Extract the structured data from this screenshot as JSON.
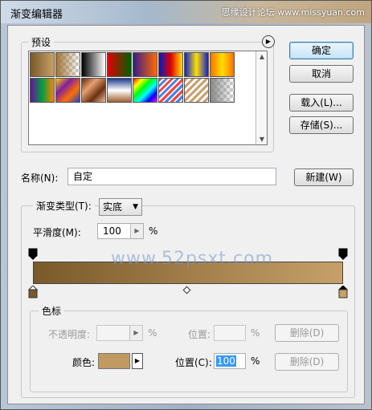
{
  "window": {
    "title": "渐变编辑器",
    "watermark_top": "思缘设计论坛 www.missyuan.com",
    "watermark_mid": "www.52psxt.com"
  },
  "presets": {
    "label": "预设",
    "menu_icon": "right-arrow-circle-icon",
    "swatches": [
      {
        "name": "foreground-to-background",
        "css": "linear-gradient(90deg,#7a5a2a,#c6a068)"
      },
      {
        "name": "foreground-to-transparent",
        "css": "linear-gradient(90deg,#a07438,rgba(160,116,56,0))"
      },
      {
        "name": "black-white",
        "css": "linear-gradient(90deg,#000,#fff)"
      },
      {
        "name": "red-green",
        "css": "linear-gradient(90deg,#e00000,#006000)"
      },
      {
        "name": "violet-orange",
        "css": "linear-gradient(90deg,#3a1a8a,#ff6a00)"
      },
      {
        "name": "blue-red-yellow",
        "css": "linear-gradient(90deg,#0018c8,#e00000,#ffe000)"
      },
      {
        "name": "blue-yellow-blue",
        "css": "linear-gradient(90deg,#1020d0,#ffe000,#1020d0)"
      },
      {
        "name": "orange-yellow-orange",
        "css": "linear-gradient(90deg,#ff7000,#ffe000,#ff7000)"
      },
      {
        "name": "violet-green-orange",
        "css": "linear-gradient(90deg,#6a10a0,#00a040,#ff8000)"
      },
      {
        "name": "yellow-violet-orange-blue",
        "css": "linear-gradient(135deg,#ffd000,#8020a0,#ff7000,#2040d0)"
      },
      {
        "name": "copper",
        "css": "linear-gradient(135deg,#5a2a10,#e8a070,#6a3010,#f0c0a0)"
      },
      {
        "name": "chrome",
        "css": "linear-gradient(180deg,#1a3a8a,#fff,#a06030)"
      },
      {
        "name": "spectrum",
        "css": "linear-gradient(135deg,#ff0000,#ffff00,#00ff00,#00ffff,#0000ff,#ff00ff)"
      },
      {
        "name": "transparent-rainbow",
        "css": "repeating-linear-gradient(135deg,#ff4040 0 3px,#ffffff 3px 5px,#4080ff 5px 8px,#ffffff 8px 10px)"
      },
      {
        "name": "transparent-stripes",
        "css": "repeating-linear-gradient(135deg,#c8a070 0 3px,#fff 3px 6px)"
      },
      {
        "name": "neutral-density",
        "css": "linear-gradient(90deg,#888,rgba(136,136,136,0))"
      }
    ]
  },
  "buttons": {
    "ok": "确定",
    "cancel": "取消",
    "load": "载入(L)...",
    "save": "存储(S)...",
    "new": "新建(W)"
  },
  "name_field": {
    "label": "名称(N):",
    "value": "自定"
  },
  "gradient": {
    "type_label": "渐变类型(T):",
    "type_value": "实底",
    "smoothness_label": "平滑度(M):",
    "smoothness_value": "100",
    "smoothness_unit": "%",
    "start_color": "#7a5a2a",
    "end_color": "#c6a068"
  },
  "color_stops": {
    "label": "色标",
    "opacity_label": "不透明度:",
    "opacity_unit": "%",
    "opacity_location_label": "位置:",
    "opacity_location_unit": "%",
    "delete_label": "删除(D)",
    "color_label": "颜色:",
    "color_value": "#c09a60",
    "location_label": "位置(C):",
    "location_value": "100",
    "location_unit": "%"
  }
}
